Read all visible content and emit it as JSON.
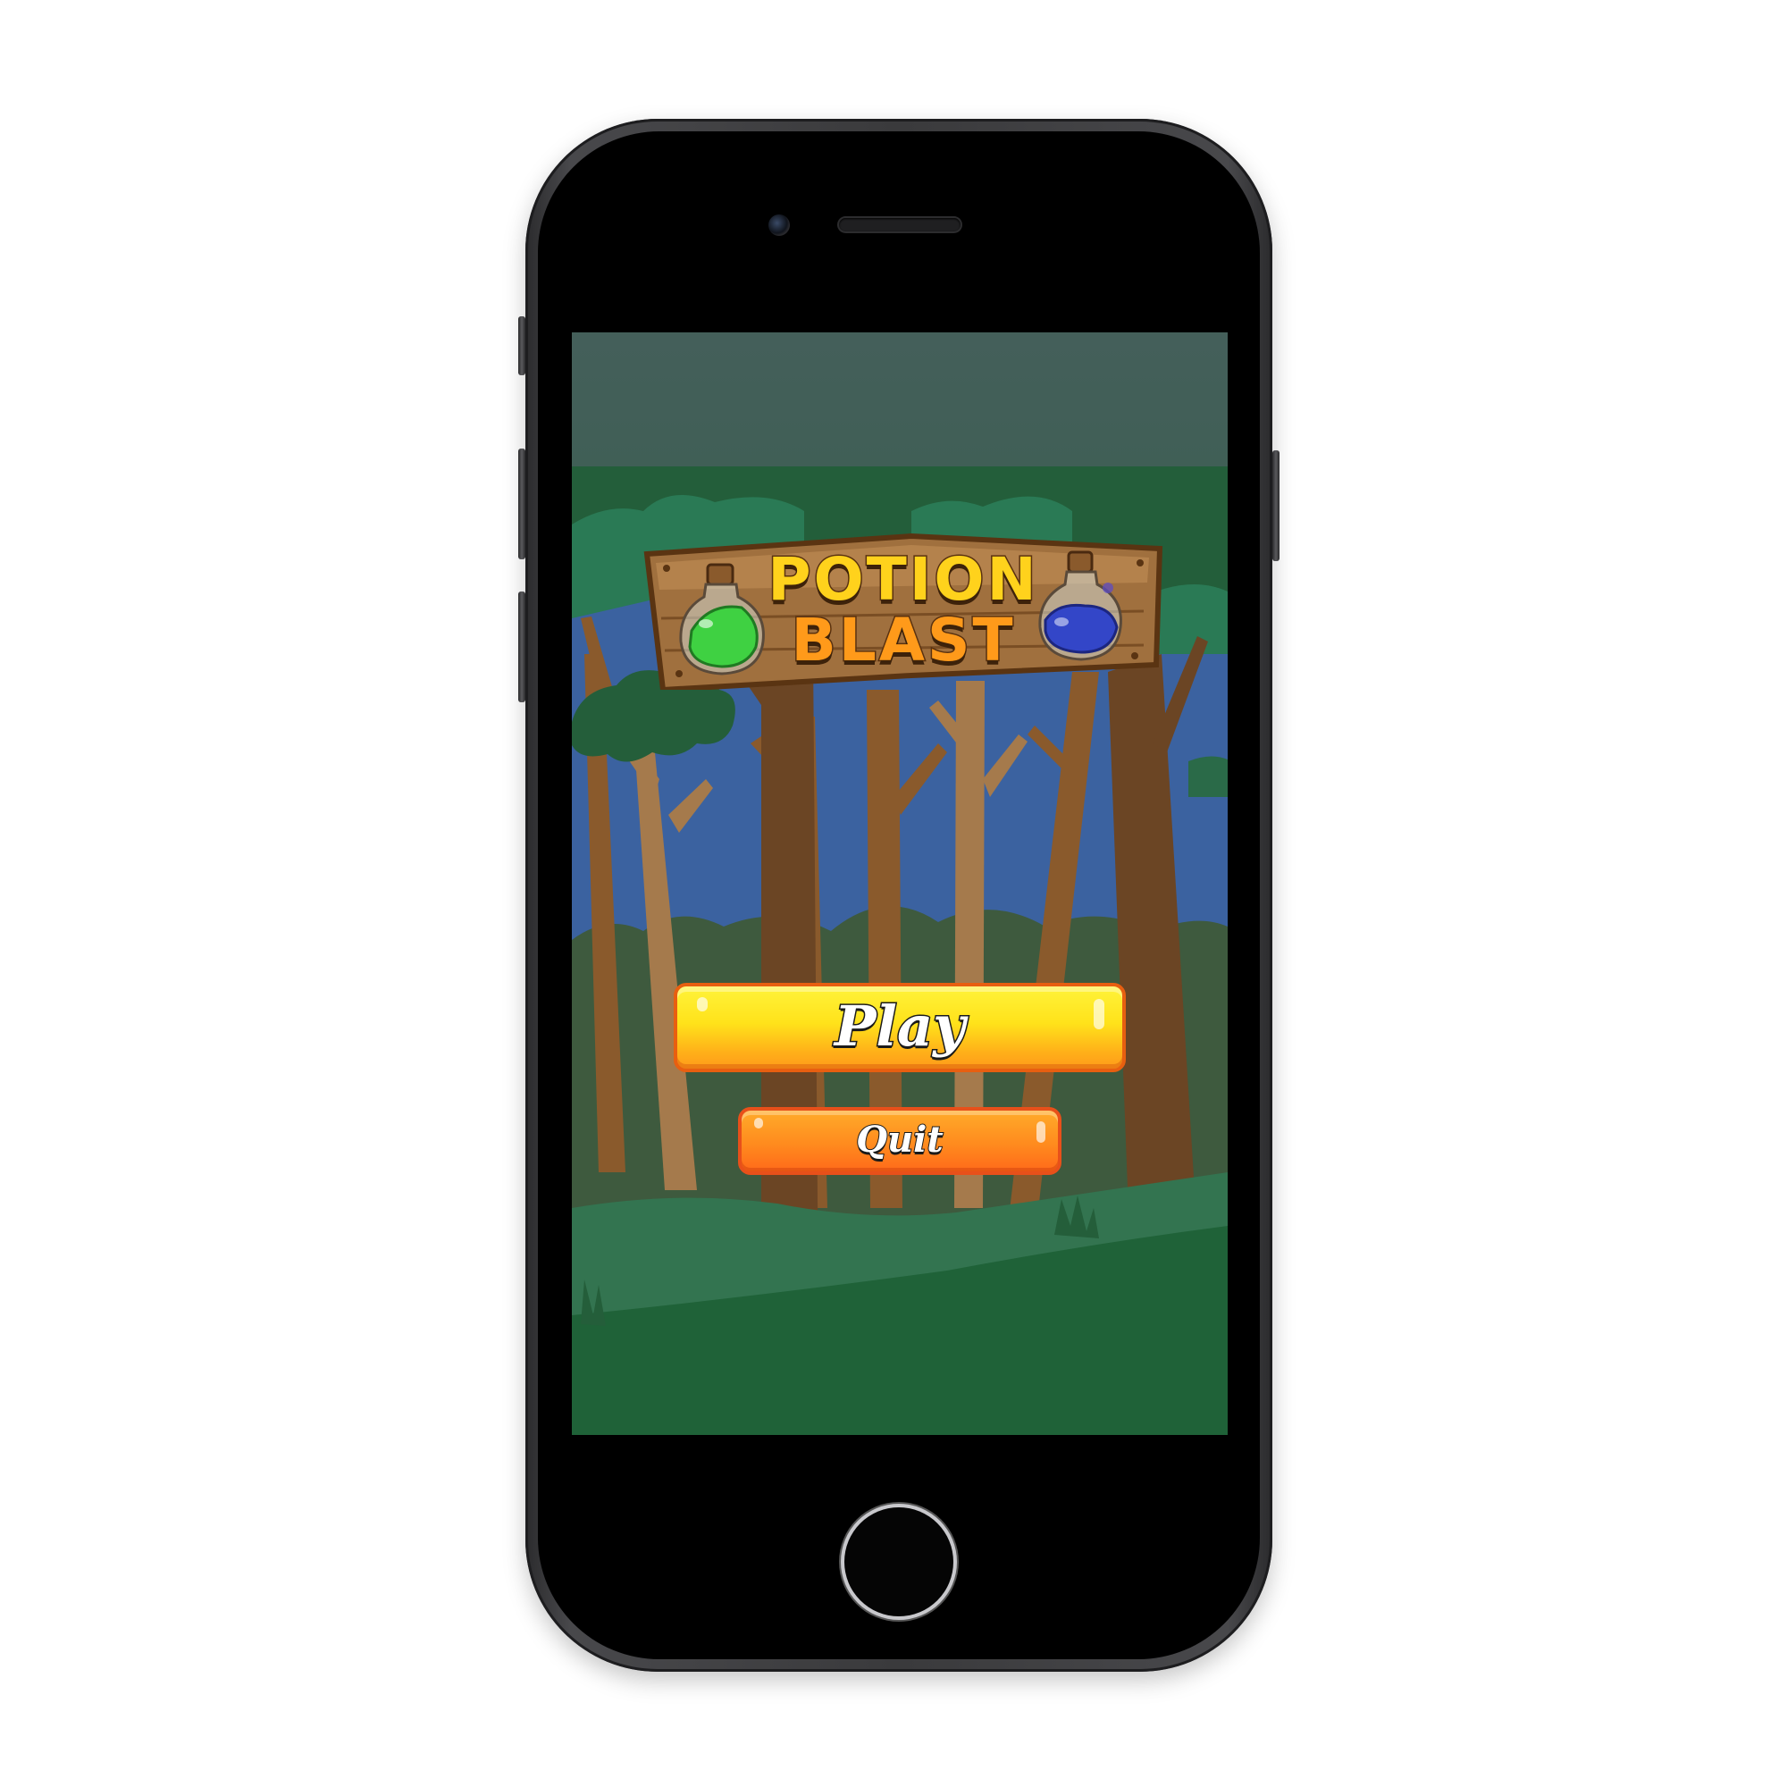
{
  "game": {
    "title_line1": "POTION",
    "title_line2": "BLAST",
    "left_potion_icon": "green-potion-icon",
    "right_potion_icon": "blue-potion-icon"
  },
  "menu": {
    "play_label": "Play",
    "quit_label": "Quit"
  },
  "colors": {
    "title_fill": "#ffd21c",
    "play_button": "#ffe21a",
    "quit_button": "#ff8b1e",
    "sky": "#3b63a0",
    "ground": "#1f6238"
  }
}
